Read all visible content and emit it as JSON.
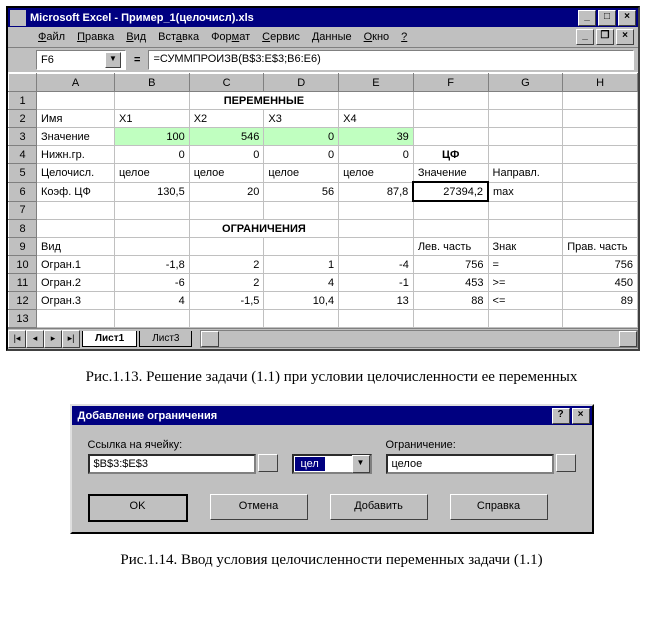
{
  "excel": {
    "title": "Microsoft Excel - Пример_1(целочисл).xls",
    "menu": {
      "file": "Файл",
      "edit": "Правка",
      "view": "Вид",
      "insert": "Вставка",
      "format": "Формат",
      "service": "Сервис",
      "data": "Данные",
      "window": "Окно",
      "help": "?"
    },
    "cellref": "F6",
    "formula_eq": "=",
    "formula": "=СУММПРОИЗВ(B$3:E$3;B6:E6)",
    "cols": [
      "A",
      "B",
      "C",
      "D",
      "E",
      "F",
      "G",
      "H"
    ],
    "rows": {
      "1": {
        "c": "ПЕРЕМЕННЫЕ"
      },
      "2": {
        "a": "Имя",
        "b": "X1",
        "c": "X2",
        "d": "X3",
        "e": "X4"
      },
      "3": {
        "a": "Значение",
        "b": "100",
        "c": "546",
        "d": "0",
        "e": "39"
      },
      "4": {
        "a": "Нижн.гр.",
        "b": "0",
        "c": "0",
        "d": "0",
        "e": "0",
        "f": "ЦФ"
      },
      "5": {
        "a": "Целочисл.",
        "b": "целое",
        "c": "целое",
        "d": "целое",
        "e": "целое",
        "f": "Значение",
        "g": "Направл."
      },
      "6": {
        "a": "Коэф. ЦФ",
        "b": "130,5",
        "c": "20",
        "d": "56",
        "e": "87,8",
        "f": "27394,2",
        "g": "max"
      },
      "8": {
        "c": "ОГРАНИЧЕНИЯ"
      },
      "9": {
        "a": "Вид",
        "f": "Лев. часть",
        "g": "Знак",
        "h": "Прав. часть"
      },
      "10": {
        "a": "Огран.1",
        "b": "-1,8",
        "c": "2",
        "d": "1",
        "e": "-4",
        "f": "756",
        "g": "=",
        "h": "756"
      },
      "11": {
        "a": "Огран.2",
        "b": "-6",
        "c": "2",
        "d": "4",
        "e": "-1",
        "f": "453",
        "g": ">=",
        "h": "450"
      },
      "12": {
        "a": "Огран.3",
        "b": "4",
        "c": "-1,5",
        "d": "10,4",
        "e": "13",
        "f": "88",
        "g": "<=",
        "h": "89"
      }
    },
    "sheets": {
      "s1": "Лист1",
      "s2": "Лист3"
    }
  },
  "caption1": "Рис.1.13. Решение задачи (1.1) при условии целочисленности ее переменных",
  "dialog": {
    "title": "Добавление ограничения",
    "lbl_ref": "Ссылка на ячейку:",
    "ref_value": "$B$3:$E$3",
    "combo_value": "цел",
    "lbl_constr": "Ограничение:",
    "constr_value": "целое",
    "btn_ok": "OK",
    "btn_cancel": "Отмена",
    "btn_add": "Добавить",
    "btn_help": "Справка"
  },
  "caption2": "Рис.1.14. Ввод условия целочисленности переменных задачи (1.1)"
}
